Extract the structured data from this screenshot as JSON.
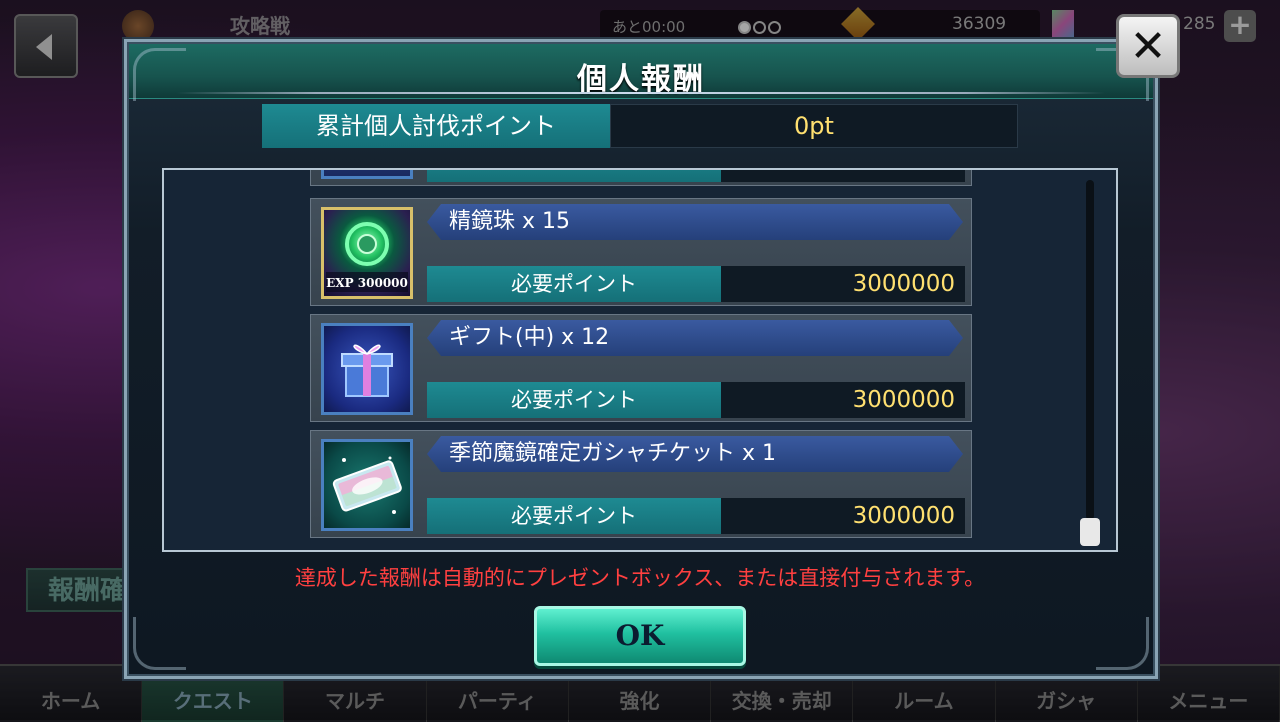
{
  "background": {
    "title": "攻略戦",
    "time": "あと00:00",
    "resource1": "36309",
    "resource2": "285",
    "plus": "+",
    "reward_button": "報酬確認",
    "nav": [
      "ホーム",
      "クエスト",
      "マルチ",
      "パーティ",
      "強化",
      "交換・売却",
      "ルーム",
      "ガシャ",
      "メニュー"
    ],
    "active_nav": "クエスト"
  },
  "modal": {
    "title": "個人報酬",
    "points_label": "累計個人討伐ポイント",
    "points_value": "0pt",
    "close": "✕",
    "rewards": [
      {
        "name": "精鏡珠 x 15",
        "required_label": "必要ポイント",
        "required_value": "3000000",
        "icon": "exp-crystal-icon",
        "icon_text": "EXP 300000"
      },
      {
        "name": "ギフト(中) x 12",
        "required_label": "必要ポイント",
        "required_value": "3000000",
        "icon": "gift-box-icon"
      },
      {
        "name": "季節魔鏡確定ガシャチケット x 1",
        "required_label": "必要ポイント",
        "required_value": "3000000",
        "icon": "gacha-ticket-icon"
      }
    ],
    "notice": "達成した報酬は自動的にプレゼントボックス、または直接付与されます。",
    "ok": "OK"
  },
  "colors": {
    "header_teal": "#17544e",
    "label_teal": "#157078",
    "value_yellow": "#ffe070",
    "notice_red": "#ff4040",
    "ok_green": "#20c0a0"
  }
}
